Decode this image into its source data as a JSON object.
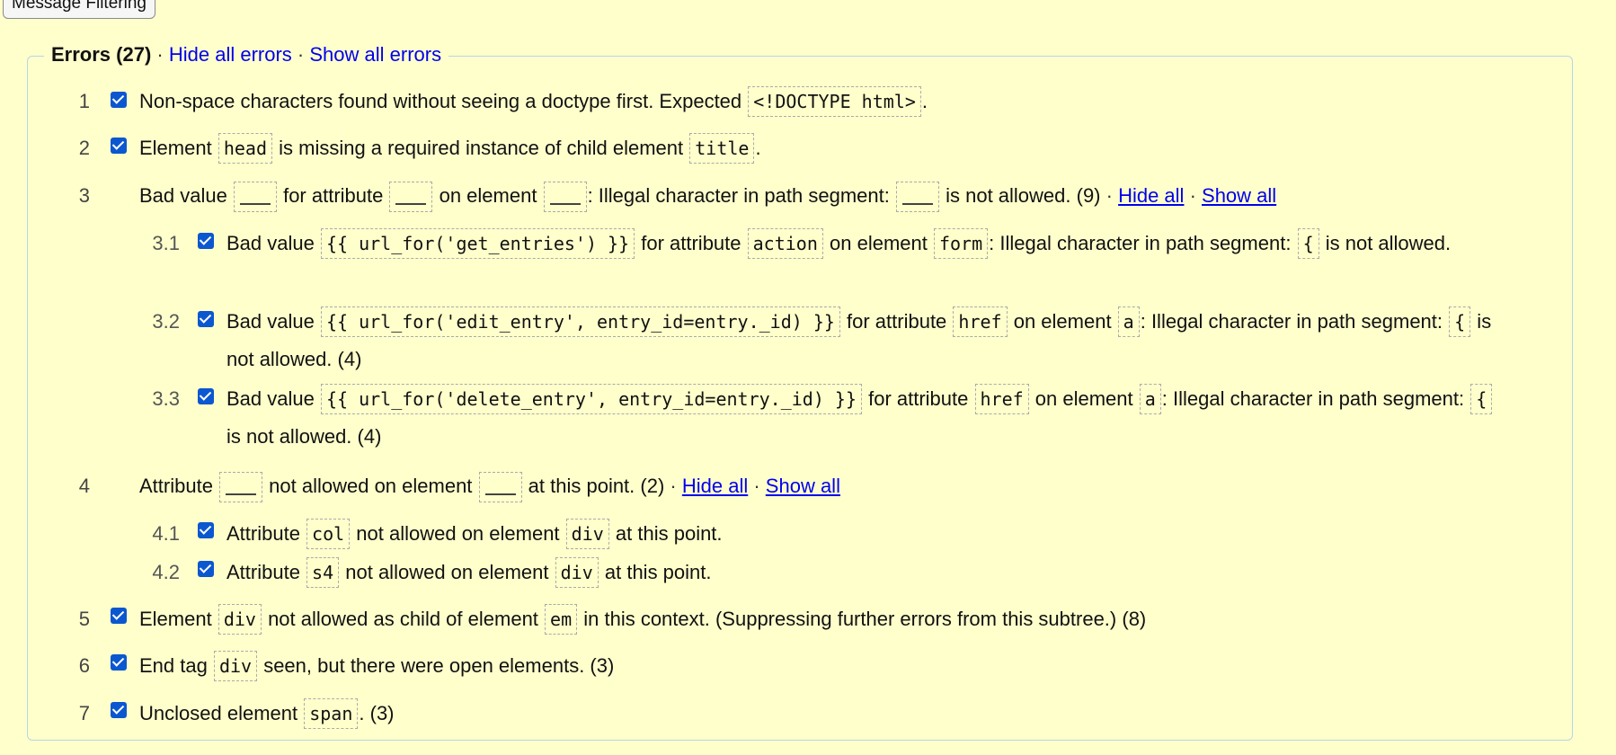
{
  "message_filtering_label": "Message Filtering",
  "errors": {
    "title": "Errors (27)",
    "hide_all_label": "Hide all errors",
    "show_all_label": "Show all errors",
    "items": [
      {
        "num": "1",
        "checked": true,
        "parts": [
          "Non-space characters found without seeing a doctype first. Expected ",
          "<!DOCTYPE html>",
          "."
        ]
      },
      {
        "num": "2",
        "checked": true,
        "parts": [
          "Element ",
          "head",
          " is missing a required instance of child element ",
          "title",
          "."
        ]
      },
      {
        "num": "3",
        "parts": [
          "Bad value ",
          " for attribute ",
          " on element ",
          ": Illegal character in path segment: ",
          " is not allowed. (9) "
        ],
        "hide_all": "Hide all",
        "show_all": "Show all",
        "children": [
          {
            "num": "3.1",
            "checked": true,
            "parts": [
              "Bad value ",
              "{{ url_for('get_entries') }}",
              " for attribute ",
              "action",
              " on element ",
              "form",
              ": Illegal character in path segment: ",
              "{",
              " is not allowed."
            ]
          },
          {
            "num": "3.2",
            "checked": true,
            "parts": [
              "Bad value ",
              "{{ url_for('edit_entry', entry_id=entry._id) }}",
              " for attribute ",
              "href",
              " on element ",
              "a",
              ": Illegal character in path segment: ",
              "{",
              " is not allowed. (4)"
            ]
          },
          {
            "num": "3.3",
            "checked": true,
            "parts": [
              "Bad value ",
              "{{ url_for('delete_entry', entry_id=entry._id) }}",
              " for attribute ",
              "href",
              " on element ",
              "a",
              ": Illegal character in path segment: ",
              "{",
              " is not allowed. (4)"
            ]
          }
        ]
      },
      {
        "num": "4",
        "parts": [
          "Attribute ",
          " not allowed on element ",
          " at this point. (2) "
        ],
        "hide_all": "Hide all",
        "show_all": "Show all",
        "children": [
          {
            "num": "4.1",
            "checked": true,
            "parts": [
              "Attribute ",
              "col",
              " not allowed on element ",
              "div",
              " at this point."
            ]
          },
          {
            "num": "4.2",
            "checked": true,
            "parts": [
              "Attribute ",
              "s4",
              " not allowed on element ",
              "div",
              " at this point."
            ]
          }
        ]
      },
      {
        "num": "5",
        "checked": true,
        "parts": [
          "Element ",
          "div",
          " not allowed as child of element ",
          "em",
          " in this context. (Suppressing further errors from this subtree.) (8)"
        ]
      },
      {
        "num": "6",
        "checked": true,
        "parts": [
          "End tag ",
          "div",
          " seen, but there were open elements. (3)"
        ]
      },
      {
        "num": "7",
        "checked": true,
        "parts": [
          "Unclosed element ",
          "span",
          ". (3)"
        ]
      }
    ]
  }
}
